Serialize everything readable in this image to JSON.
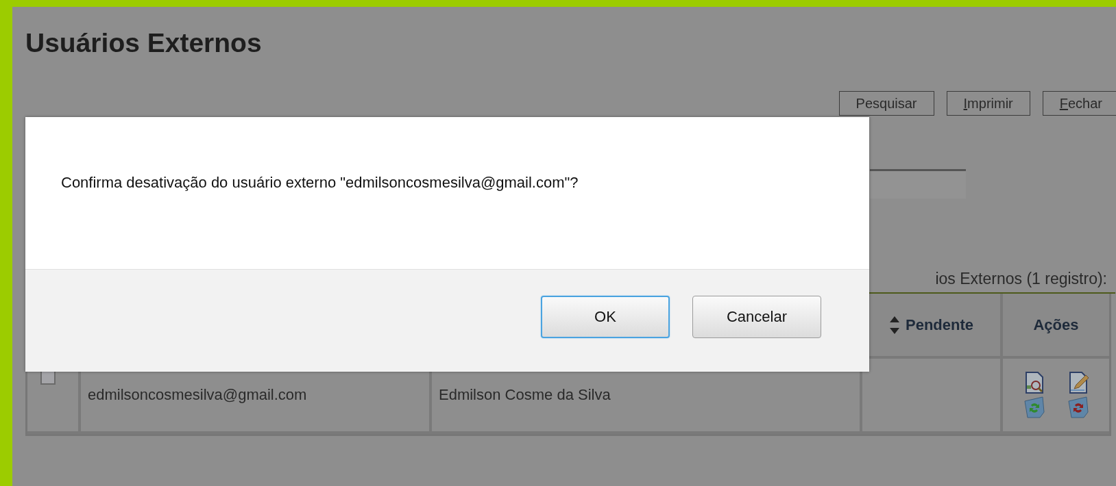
{
  "page": {
    "title": "Usuários Externos"
  },
  "toolbar": [
    {
      "label": "Pesquisar",
      "mnemonic_underlined": false
    },
    {
      "label": "Imprimir",
      "mnemonic_underlined": true
    },
    {
      "label": "Fechar",
      "mnemonic_underlined": true
    }
  ],
  "table": {
    "caption": "ios Externos (1 registro):",
    "columns": [
      {
        "label": "Pendente",
        "sortable": true
      },
      {
        "label": "Ações",
        "sortable": false
      }
    ],
    "rows": [
      {
        "checked": false,
        "email": "edmilsoncosmesilva@gmail.com",
        "name": "Edmilson Cosme da Silva",
        "actions": [
          {
            "kind": "view"
          },
          {
            "kind": "edit"
          },
          {
            "kind": "activate"
          },
          {
            "kind": "deactivate"
          }
        ]
      }
    ]
  },
  "dialog": {
    "message": "Confirma desativação do usuário externo \"edmilsoncosmesilva@gmail.com\"?",
    "buttons": [
      {
        "label": "OK",
        "focused": true
      },
      {
        "label": "Cancelar",
        "focused": false
      }
    ]
  }
}
